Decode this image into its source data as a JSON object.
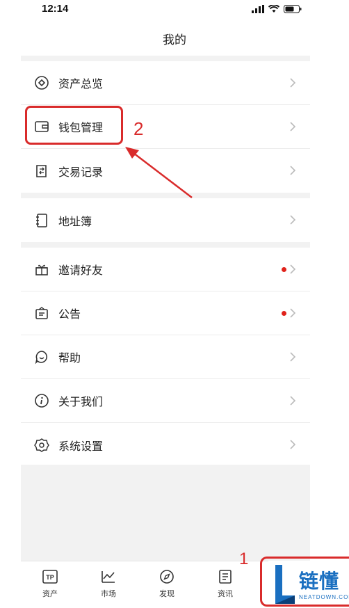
{
  "status": {
    "time": "12:14"
  },
  "header": {
    "title": "我的"
  },
  "sections": [
    {
      "items": [
        {
          "label": "资产总览",
          "icon": "asset-overview-icon"
        },
        {
          "label": "钱包管理",
          "icon": "wallet-icon"
        },
        {
          "label": "交易记录",
          "icon": "transaction-record-icon"
        }
      ]
    },
    {
      "items": [
        {
          "label": "地址簿",
          "icon": "address-book-icon"
        }
      ]
    },
    {
      "items": [
        {
          "label": "邀请好友",
          "icon": "gift-icon",
          "badge": true
        },
        {
          "label": "公告",
          "icon": "announcement-icon",
          "badge": true
        },
        {
          "label": "帮助",
          "icon": "help-icon"
        },
        {
          "label": "关于我们",
          "icon": "info-icon"
        },
        {
          "label": "系统设置",
          "icon": "settings-icon"
        }
      ]
    }
  ],
  "tabs": [
    {
      "label": "资产",
      "icon": "tp-wallet-icon"
    },
    {
      "label": "市场",
      "icon": "market-chart-icon"
    },
    {
      "label": "发现",
      "icon": "compass-icon"
    },
    {
      "label": "资讯",
      "icon": "news-icon"
    }
  ],
  "annotations": {
    "step1": "1",
    "step2": "2"
  },
  "watermark": {
    "text": "链懂",
    "sub": "NEATDOWN.COM"
  },
  "colors": {
    "annotation": "#d92b2b",
    "badge": "#e0221b",
    "divider_band": "#f2f2f2"
  }
}
